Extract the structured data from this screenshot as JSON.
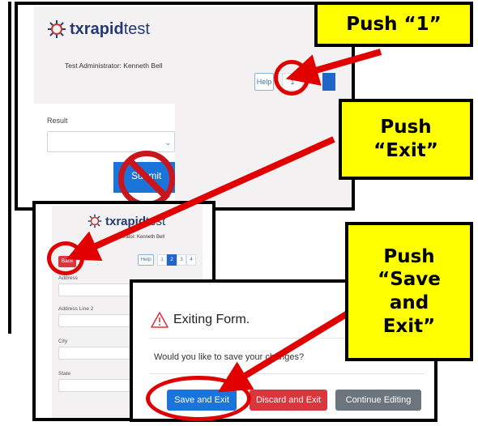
{
  "colors": {
    "accent_yellow": "#ffff00",
    "arrow_red": "#e00000",
    "primary_blue": "#1b74d9",
    "danger_red": "#d9363e",
    "secondary_gray": "#6c757d",
    "logo_blue": "#253a73"
  },
  "screen1": {
    "logo": {
      "tx": "tx",
      "rapid": "rapid",
      "test": "test",
      "icon": "virus-icon"
    },
    "admin": "Test Administrator: Kenneth Bell",
    "help": "Help",
    "page1": "1",
    "result_label": "Result",
    "submit": "Submit"
  },
  "screen2": {
    "logo": {
      "tx": "tx",
      "rapid": "rapid",
      "test": "test"
    },
    "admin": "nistrator: Kenneth Bell",
    "back": "Back",
    "help": "Help",
    "pages": [
      "1",
      "2",
      "3",
      "4"
    ],
    "fields": [
      "Address",
      "Address Line 2",
      "City",
      "State"
    ]
  },
  "modal": {
    "title": "Exiting Form.",
    "icon": "warning-icon",
    "body": "Would you like to save your changes?",
    "buttons": {
      "save": "Save and Exit",
      "discard": "Discard and Exit",
      "continue": "Continue Editing"
    }
  },
  "callouts": {
    "one": "Push “1”",
    "exit_1": "Push",
    "exit_2": "“Exit”",
    "save_1": "Push",
    "save_2": "“Save",
    "save_3": "and",
    "save_4": "Exit”"
  }
}
